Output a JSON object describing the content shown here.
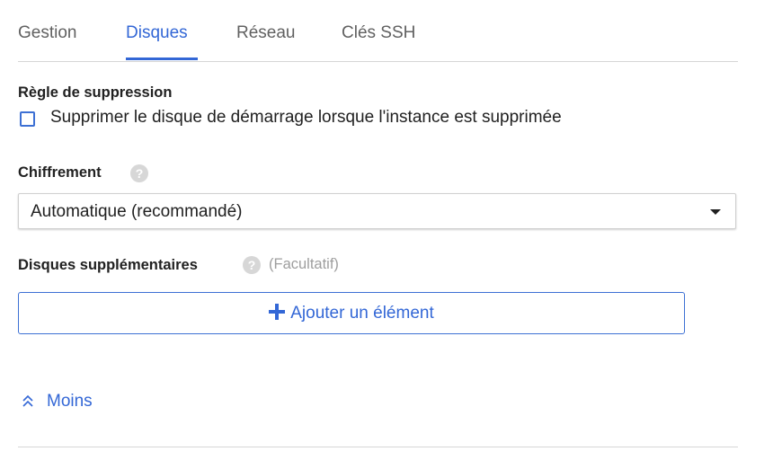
{
  "tabs": [
    {
      "label": "Gestion",
      "active": false
    },
    {
      "label": "Disques",
      "active": true
    },
    {
      "label": "Réseau",
      "active": false
    },
    {
      "label": "Clés SSH",
      "active": false
    }
  ],
  "deletion_rule": {
    "title": "Règle de suppression",
    "checkbox_label": "Supprimer le disque de démarrage lorsque l'instance est supprimée",
    "checked": false
  },
  "encryption": {
    "title": "Chiffrement",
    "help_icon": "help-icon",
    "selected_value": "Automatique (recommandé)"
  },
  "additional_disks": {
    "title": "Disques supplémentaires",
    "help_icon": "help-icon",
    "optional_label": "(Facultatif)",
    "add_button_label": "Ajouter un élément"
  },
  "less_link": {
    "label": "Moins",
    "icon": "chevron-up-double-icon"
  },
  "colors": {
    "accent": "#3367d6",
    "text": "#212121",
    "muted": "#9e9e9e",
    "divider": "#d6d6d6"
  }
}
